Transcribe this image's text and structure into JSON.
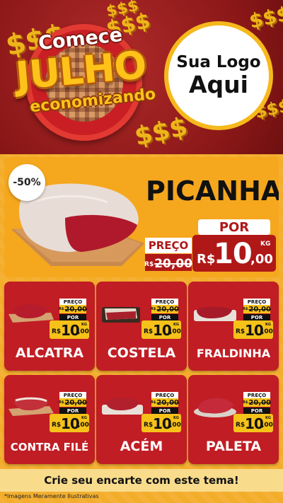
{
  "hero": {
    "headline_top": "Comece",
    "headline_main": "JULHO",
    "headline_bottom": "economizando",
    "decor_symbol": "$$$",
    "logo_line1": "Sua Logo",
    "logo_line2": "Aqui",
    "colors": {
      "background": "#8a1717",
      "gold": "#f6c21a"
    }
  },
  "featured": {
    "discount": "-50%",
    "name": "PICANHA",
    "preco_label": "PREÇO",
    "old_currency": "R$",
    "old_price": "20,00",
    "por_label": "POR",
    "currency": "R$",
    "price_int": "10",
    "price_dec": ",00",
    "unit": "KG"
  },
  "products": [
    {
      "name": "ALCATRA",
      "preco_label": "PREÇO",
      "old_currency": "R$",
      "old_price": "20,00",
      "por_label": "POR",
      "currency": "R$",
      "price_int": "10",
      "price_dec": ",00",
      "unit": "KG"
    },
    {
      "name": "COSTELA",
      "preco_label": "PREÇO",
      "old_currency": "R$",
      "old_price": "20,00",
      "por_label": "POR",
      "currency": "R$",
      "price_int": "10",
      "price_dec": ",00",
      "unit": "KG"
    },
    {
      "name": "FRALDINHA",
      "preco_label": "PREÇO",
      "old_currency": "R$",
      "old_price": "20,00",
      "por_label": "POR",
      "currency": "R$",
      "price_int": "10",
      "price_dec": ",00",
      "unit": "KG"
    },
    {
      "name": "CONTRA FILÉ",
      "preco_label": "PREÇO",
      "old_currency": "R$",
      "old_price": "20,00",
      "por_label": "POR",
      "currency": "R$",
      "price_int": "10",
      "price_dec": ",00",
      "unit": "KG"
    },
    {
      "name": "ACÉM",
      "preco_label": "PREÇO",
      "old_currency": "R$",
      "old_price": "20,00",
      "por_label": "POR",
      "currency": "R$",
      "price_int": "10",
      "price_dec": ",00",
      "unit": "KG"
    },
    {
      "name": "PALETA",
      "preco_label": "PREÇO",
      "old_currency": "R$",
      "old_price": "20,00",
      "por_label": "POR",
      "currency": "R$",
      "price_int": "10",
      "price_dec": ",00",
      "unit": "KG"
    }
  ],
  "cta": "Crie seu encarte com este tema!",
  "disclaimer": "*Imagens Meramente Ilustrativas",
  "colors": {
    "card_red": "#c11d24",
    "price_yellow": "#f6c21a",
    "background_orange": "#f3ad2b"
  }
}
